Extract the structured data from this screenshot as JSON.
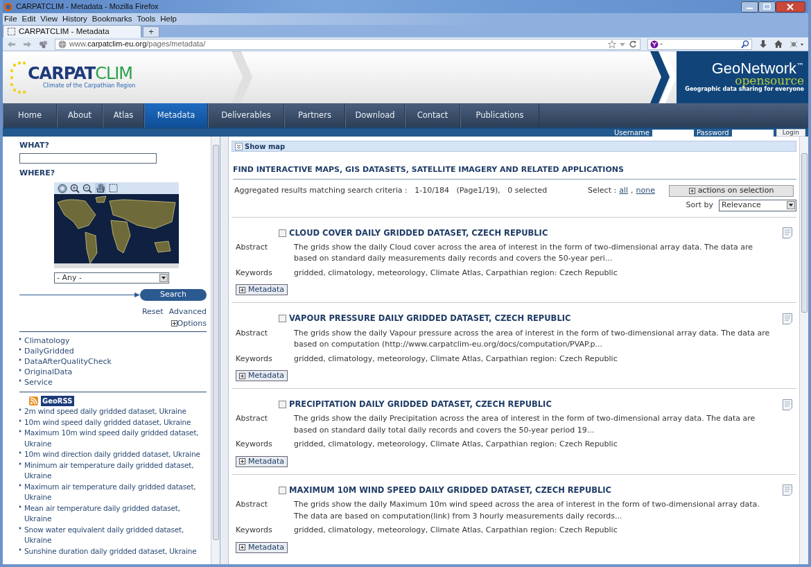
{
  "window": {
    "title": "CARPATCLIM - Metadata - Mozilla Firefox"
  },
  "menu": [
    {
      "label": "File"
    },
    {
      "label": "Edit"
    },
    {
      "label": "View"
    },
    {
      "label": "History"
    },
    {
      "label": "Bookmarks"
    },
    {
      "label": "Tools"
    },
    {
      "label": "Help"
    }
  ],
  "tabs": [
    {
      "label": "CARPATCLIM - Metadata",
      "selected": true
    }
  ],
  "new_tab": "+",
  "address": "www.**carpatclim-eu.org**/pages/metadata/",
  "site": {
    "logo_a": "CARPAT",
    "logo_b": "CLIM",
    "tagline": "Climate of the Carpathian Region",
    "gn_a": "GeoNetwork",
    "gn_b": "opensource",
    "gn_tm": "™",
    "gn_tagline": "Geographic data sharing for everyone"
  },
  "nav": [
    {
      "label": "Home",
      "selected": false
    },
    {
      "label": "About",
      "selected": false
    },
    {
      "label": "Atlas",
      "selected": false
    },
    {
      "label": "Metadata",
      "selected": true
    },
    {
      "label": "Deliverables",
      "selected": false
    },
    {
      "label": "Partners",
      "selected": false
    },
    {
      "label": "Download",
      "selected": false
    },
    {
      "label": "Contact",
      "selected": false
    },
    {
      "label": "Publications",
      "selected": false
    }
  ],
  "login": {
    "username_label": "Username",
    "password_label": "Password",
    "button": "Login"
  },
  "search": {
    "what_label": "WHAT?",
    "where_label": "WHERE?",
    "region": "- Any -",
    "button": "Search",
    "reset": "Reset",
    "advanced": "Advanced",
    "options": "Options"
  },
  "categories": [
    "Climatology",
    "DailyGridded",
    "DataAfterQualityCheck",
    "OriginalData",
    "Service"
  ],
  "georss": {
    "label": "GeoRSS",
    "items": [
      "2m wind speed daily gridded dataset, Ukraine",
      "10m wind speed daily gridded dataset, Ukraine",
      "Maximum 10m wind speed daily gridded dataset, Ukraine",
      "10m wind direction daily gridded dataset, Ukraine",
      "Minimum air temperature daily gridded dataset, Ukraine",
      "Maximum air temperature daily gridded dataset, Ukraine",
      "Mean air temperature daily gridded dataset, Ukraine",
      "Snow water equivalent daily gridded dataset, Ukraine",
      "Sunshine duration daily gridded dataset, Ukraine"
    ]
  },
  "results_panel": {
    "show_map": "Show map",
    "heading": "FIND INTERACTIVE MAPS, GIS DATASETS, SATELLITE IMAGERY AND RELATED APPLICATIONS",
    "summary": "Aggregated results matching search criteria :   1-10/184   (Page1/19),   0 selected",
    "select_label": "Select :",
    "select_all": "all",
    "select_separator": ",",
    "select_none": "none",
    "actions": "actions on selection",
    "sort_label": "Sort by",
    "sort_value": "Relevance"
  },
  "results": [
    {
      "title": "CLOUD COVER DAILY GRIDDED DATASET, CZECH REPUBLIC",
      "checked": false,
      "abstract_label": "Abstract",
      "abstract": "The grids show the daily Cloud cover across the area of interest in the form of two-dimensional array data. The data are based on standard daily measurements daily records and covers the 50-year peri...",
      "keywords_label": "Keywords",
      "keywords": "gridded, climatology, meteorology, Climate Atlas, Carpathian region: Czech Republic",
      "button": "Metadata"
    },
    {
      "title": "VAPOUR PRESSURE DAILY GRIDDED DATASET, CZECH REPUBLIC",
      "checked": false,
      "abstract_label": "Abstract",
      "abstract": "The grids show the daily Vapour pressure across the area of interest in the form of two-dimensional array data. The data are based on computation (http://www.carpatclim-eu.org/docs/computation/PVAP.p...",
      "keywords_label": "Keywords",
      "keywords": "gridded, climatology, meteorology, Climate Atlas, Carpathian region: Czech Republic",
      "button": "Metadata"
    },
    {
      "title": "PRECIPITATION DAILY GRIDDED DATASET, CZECH REPUBLIC",
      "checked": false,
      "abstract_label": "Abstract",
      "abstract": "The grids show the daily Precipitation across the area of interest in the form of two-dimensional array data. The data are based on standard daily total daily records and covers the 50-year period 19...",
      "keywords_label": "Keywords",
      "keywords": "gridded, climatology, meteorology, Climate Atlas, Carpathian region: Czech Republic",
      "button": "Metadata"
    },
    {
      "title": "MAXIMUM 10M WIND SPEED DAILY GRIDDED DATASET, CZECH REPUBLIC",
      "checked": false,
      "abstract_label": "Abstract",
      "abstract": "The grids show the daily Maximum 10m wind speed across the area of interest in the form of two-dimensional array data. The data are based on computation(link) from 3 hourly measurements daily records...",
      "keywords_label": "Keywords",
      "keywords": "gridded, climatology, meteorology, Climate Atlas, Carpathian region: Czech Republic",
      "button": "Metadata"
    }
  ]
}
